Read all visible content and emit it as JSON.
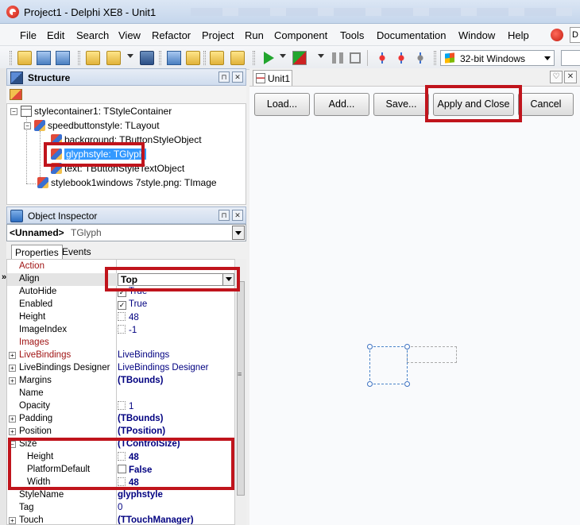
{
  "window": {
    "title": "Project1 - Delphi XE8 - Unit1"
  },
  "menu": {
    "items": [
      "File",
      "Edit",
      "Search",
      "View",
      "Refactor",
      "Project",
      "Run",
      "Component",
      "Tools",
      "Documentation",
      "Window",
      "Help"
    ]
  },
  "toolbar": {
    "platform": "32-bit Windows"
  },
  "structure": {
    "title": "Structure",
    "nodes": [
      "stylecontainer1: TStyleContainer",
      "speedbuttonstyle: TLayout",
      "background: TButtonStyleObject",
      "glyphstyle: TGlyph",
      "text: TButtonStyleTextObject",
      "stylebook1windows 7style.png: TImage"
    ]
  },
  "object_inspector": {
    "title": "Object Inspector",
    "selected_name": "<Unnamed>",
    "selected_type": "TGlyph",
    "tabs": [
      "Properties",
      "Events"
    ],
    "rows": [
      {
        "name": "Action",
        "value": "",
        "category": true
      },
      {
        "name": "Align",
        "value": "Top"
      },
      {
        "name": "AutoHide",
        "value": "True"
      },
      {
        "name": "Enabled",
        "value": "True"
      },
      {
        "name": "Height",
        "value": "48"
      },
      {
        "name": "ImageIndex",
        "value": "-1"
      },
      {
        "name": "Images",
        "value": "",
        "category": true
      },
      {
        "name": "LiveBindings",
        "value": "LiveBindings",
        "category": true
      },
      {
        "name": "LiveBindings Designer",
        "value": "LiveBindings Designer"
      },
      {
        "name": "Margins",
        "value": "(TBounds)"
      },
      {
        "name": "Name",
        "value": ""
      },
      {
        "name": "Opacity",
        "value": "1"
      },
      {
        "name": "Padding",
        "value": "(TBounds)"
      },
      {
        "name": "Position",
        "value": "(TPosition)"
      },
      {
        "name": "Size",
        "value": "(TControlSize)"
      },
      {
        "name": "Height",
        "value": "48"
      },
      {
        "name": "PlatformDefault",
        "value": "False"
      },
      {
        "name": "Width",
        "value": "48"
      },
      {
        "name": "StyleName",
        "value": "glyphstyle"
      },
      {
        "name": "Tag",
        "value": "0"
      },
      {
        "name": "Touch",
        "value": "(TTouchManager)"
      }
    ]
  },
  "editor": {
    "tab_label": "Unit1",
    "buttons": [
      "Load...",
      "Add...",
      "Save...",
      "Apply and Close",
      "Cancel"
    ]
  },
  "colors": {
    "annotation": "#c0141c",
    "selection": "#3399ff",
    "value_text": "#000080",
    "category_text": "#a01414"
  }
}
